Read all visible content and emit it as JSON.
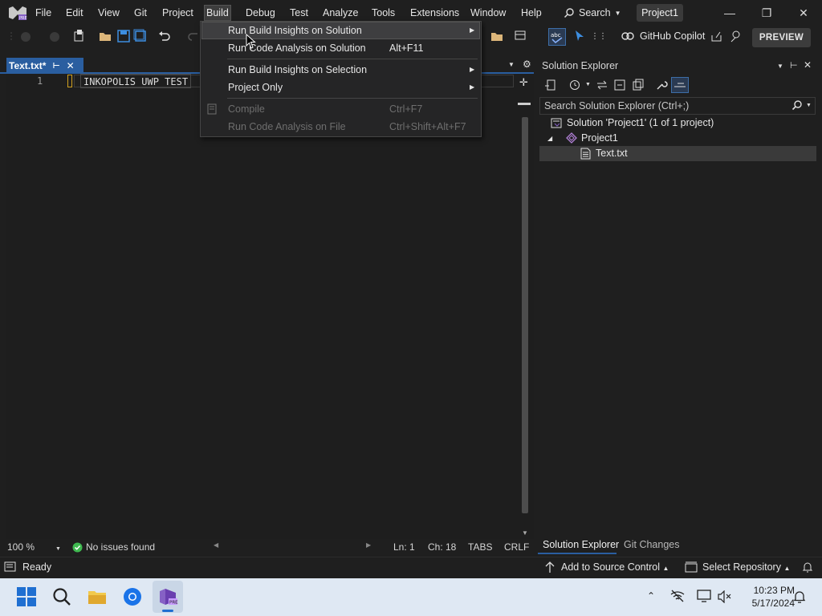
{
  "menubar": {
    "items": [
      "File",
      "Edit",
      "View",
      "Git",
      "Project",
      "Build",
      "Debug",
      "Test",
      "Analyze",
      "Tools",
      "Extensions",
      "Window",
      "Help"
    ],
    "search_label": "Search",
    "project_badge": "Project1"
  },
  "toolbar": {
    "copilot_label": "GitHub Copilot",
    "preview_label": "PREVIEW"
  },
  "editor": {
    "tab_label": "Text.txt*",
    "line_number": "1",
    "code_line": "INKOPOLIS UWP TEST",
    "zoom": "100 %",
    "issues": "No issues found",
    "line_col": "Ln: 1",
    "char_col": "Ch: 18",
    "indent": "TABS",
    "line_ending": "CRLF"
  },
  "build_menu": {
    "items": [
      {
        "label": "Run Build Insights on Solution",
        "shortcut": "",
        "submenu": true,
        "enabled": true,
        "highlighted": true
      },
      {
        "label": "Run Code Analysis on Solution",
        "shortcut": "Alt+F11",
        "submenu": false,
        "enabled": true
      },
      {
        "label": "Run Build Insights on Selection",
        "shortcut": "",
        "submenu": true,
        "enabled": true
      },
      {
        "label": "Project Only",
        "shortcut": "",
        "submenu": true,
        "enabled": true
      },
      {
        "label": "Compile",
        "shortcut": "Ctrl+F7",
        "submenu": false,
        "enabled": false
      },
      {
        "label": "Run Code Analysis on File",
        "shortcut": "Ctrl+Shift+Alt+F7",
        "submenu": false,
        "enabled": false
      }
    ]
  },
  "solution_explorer": {
    "title": "Solution Explorer",
    "search_placeholder": "Search Solution Explorer (Ctrl+;)",
    "solution_label": "Solution 'Project1' (1 of 1 project)",
    "project_label": "Project1",
    "file_label": "Text.txt",
    "bottom_tabs": [
      "Solution Explorer",
      "Git Changes"
    ]
  },
  "statusbar": {
    "ready": "Ready",
    "source_control": "Add to Source Control",
    "repository": "Select Repository"
  },
  "taskbar": {
    "time": "10:23 PM",
    "date": "5/17/2024"
  },
  "colors": {
    "accent": "#2a5ea0",
    "vs_purple": "#8661c5",
    "success_green": "#3fb950"
  }
}
